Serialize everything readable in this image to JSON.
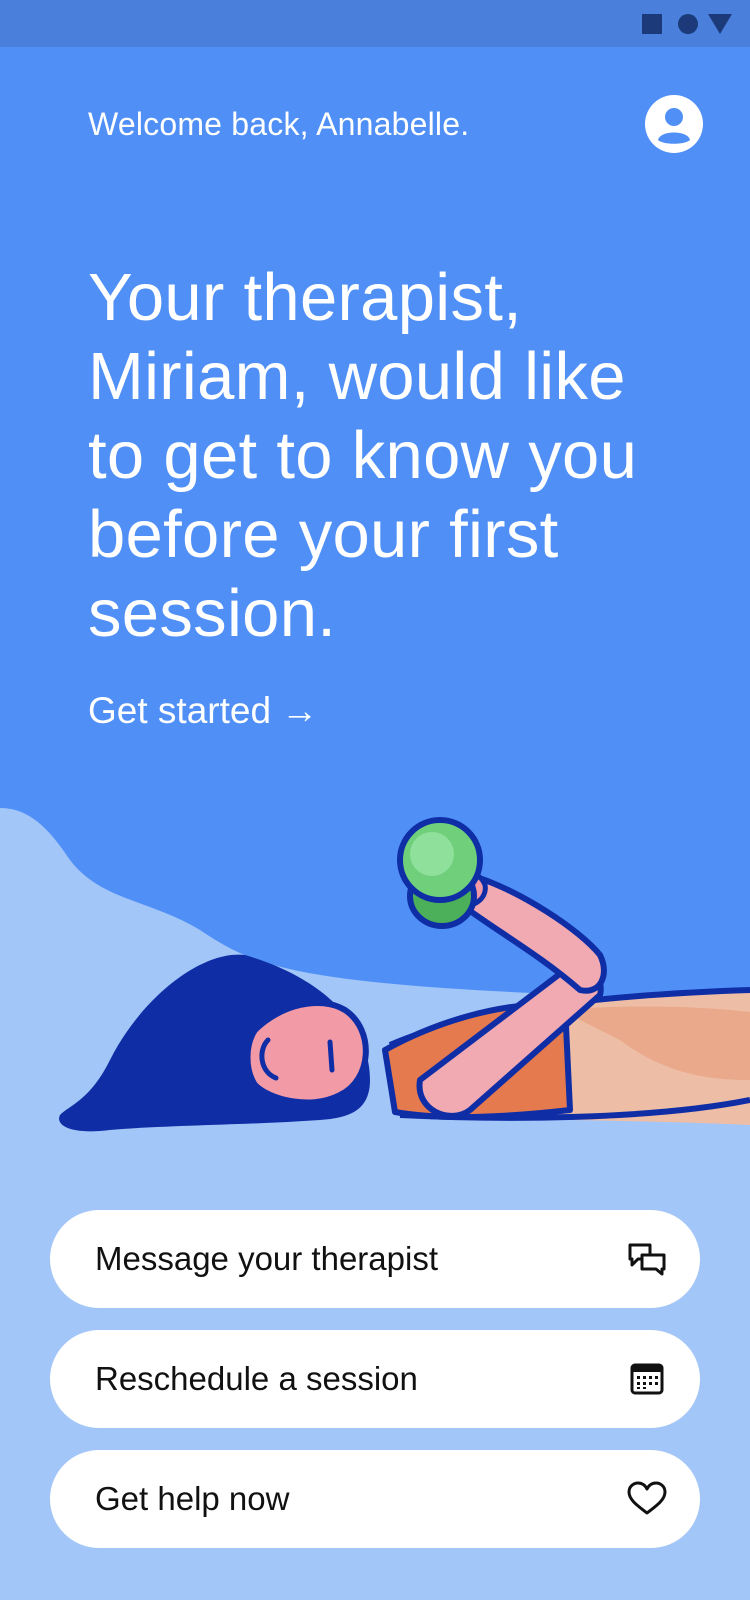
{
  "status_bar": {
    "icons": [
      "square-icon",
      "circle-icon",
      "triangle-icon"
    ]
  },
  "header": {
    "welcome": "Welcome back, Annabelle.",
    "avatar_icon": "user-profile-icon"
  },
  "hero": {
    "headline": "Your therapist, Miriam, would like to get to know you before your first session.",
    "cta_label": "Get started →"
  },
  "illustration": {
    "subject": "woman-lying-lifting-dumbbell"
  },
  "actions": [
    {
      "label": "Message your therapist",
      "icon": "chat-bubbles-icon"
    },
    {
      "label": "Reschedule a session",
      "icon": "calendar-icon"
    },
    {
      "label": "Get help now",
      "icon": "heart-icon"
    }
  ],
  "colors": {
    "background": "#5090f6",
    "status_bar": "#4a80dc",
    "light_blue": "#a3c6f8",
    "hair": "#0f2ea6",
    "dumbbell": "#6fcf7a",
    "text_on_blue": "#ffffff"
  }
}
